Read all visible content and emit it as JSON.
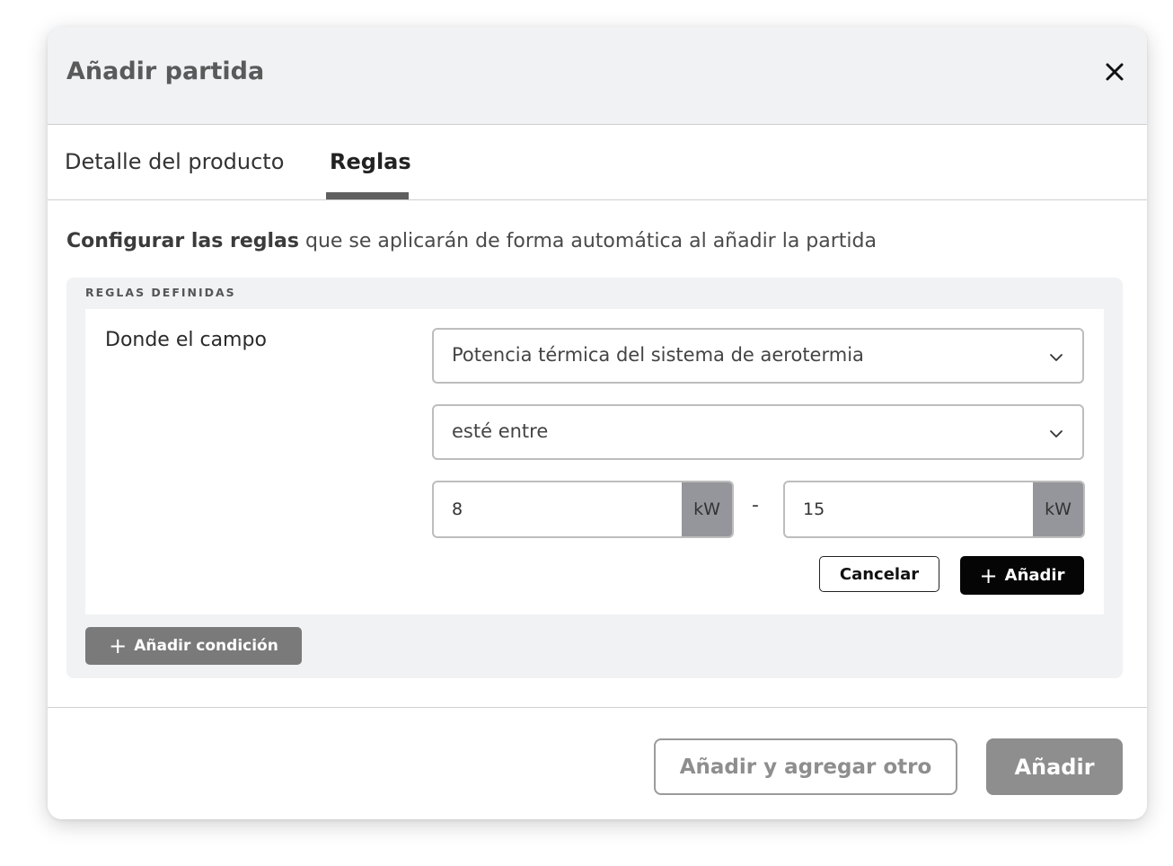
{
  "dialog": {
    "title": "Añadir partida",
    "close_icon": "close-icon"
  },
  "tabs": [
    {
      "label": "Detalle del producto",
      "active": false
    },
    {
      "label": "Reglas",
      "active": true
    }
  ],
  "intro": {
    "bold": "Configurar las reglas",
    "rest": " que se aplicarán de forma automática al añadir la partida"
  },
  "rules": {
    "caption": "REGLAS DEFINIDAS",
    "field_label": "Donde el campo",
    "field_select": "Potencia térmica del sistema de aerotermia",
    "operator_select": "esté entre",
    "min_value": "8",
    "max_value": "15",
    "unit": "kW",
    "separator": "-",
    "cancel_label": "Cancelar",
    "add_label": "Añadir",
    "add_condition_label": "Añadir condición"
  },
  "footer": {
    "add_another_label": "Añadir y agregar otro",
    "add_label": "Añadir"
  },
  "colors": {
    "header_bg": "#f1f2f4",
    "primary_dark": "#050505",
    "muted_button": "#8e8e8e",
    "unit_badge": "#95969b"
  }
}
